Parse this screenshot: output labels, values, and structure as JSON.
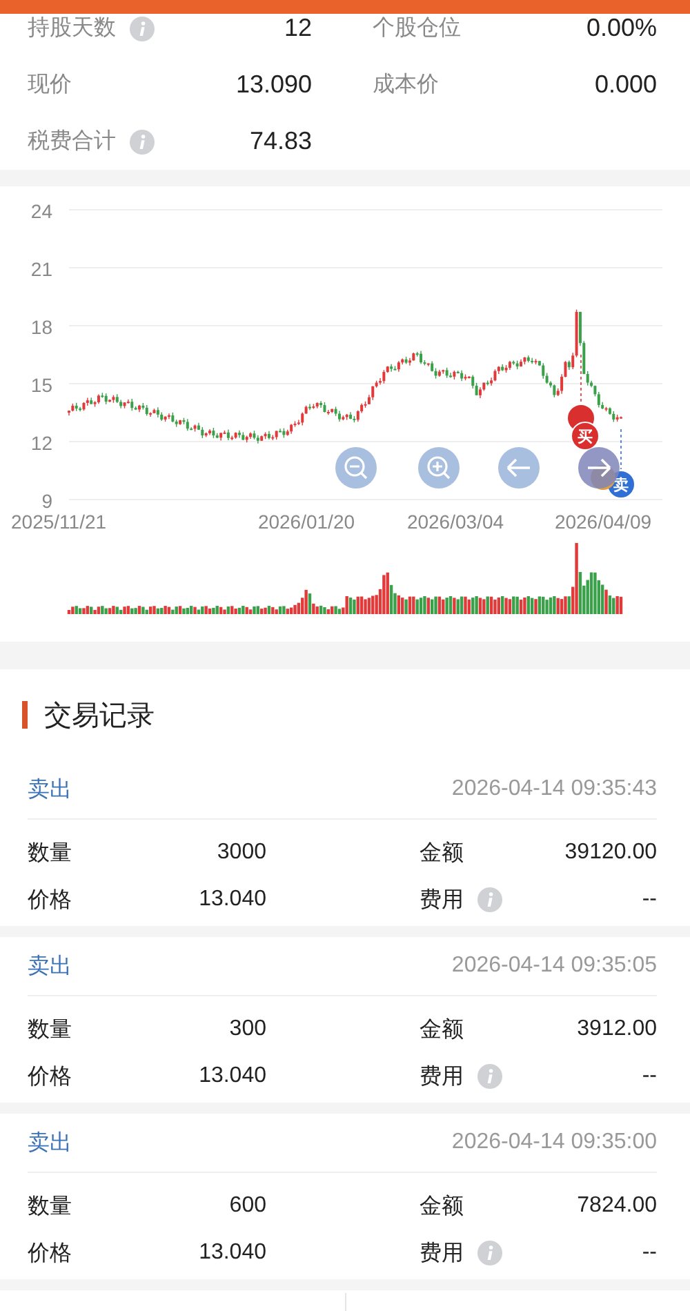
{
  "stats": [
    {
      "label": "持股天数",
      "info": true,
      "value": "12"
    },
    {
      "label": "个股仓位",
      "info": false,
      "value": "0.00%"
    },
    {
      "label": "现价",
      "info": false,
      "value": "13.090"
    },
    {
      "label": "成本价",
      "info": false,
      "value": "0.000"
    },
    {
      "label": "税费合计",
      "info": true,
      "value": "74.83"
    }
  ],
  "chart": {
    "y_labels": [
      "24",
      "21",
      "18",
      "15",
      "12",
      "9"
    ],
    "x_labels": [
      "2025/11/21",
      "2026/01/20",
      "2026/03/04",
      "2026/04/09"
    ],
    "markers": [
      {
        "kind": "buy"
      },
      {
        "kind": "buy",
        "text": "买"
      },
      {
        "kind": "sell",
        "text": "卖"
      }
    ]
  },
  "section_title": "交易记录",
  "trades": [
    {
      "type": "卖出",
      "time": "2026-04-14 09:35:43",
      "fields": [
        {
          "label": "数量",
          "value": "3000",
          "info": false
        },
        {
          "label": "金额",
          "value": "39120.00",
          "info": false
        },
        {
          "label": "价格",
          "value": "13.040",
          "info": false
        },
        {
          "label": "费用",
          "value": "--",
          "info": true
        }
      ]
    },
    {
      "type": "卖出",
      "time": "2026-04-14 09:35:05",
      "fields": [
        {
          "label": "数量",
          "value": "300",
          "info": false
        },
        {
          "label": "金额",
          "value": "3912.00",
          "info": false
        },
        {
          "label": "价格",
          "value": "13.040",
          "info": false
        },
        {
          "label": "费用",
          "value": "--",
          "info": true
        }
      ]
    },
    {
      "type": "卖出",
      "time": "2026-04-14 09:35:00",
      "fields": [
        {
          "label": "数量",
          "value": "600",
          "info": false
        },
        {
          "label": "金额",
          "value": "7824.00",
          "info": false
        },
        {
          "label": "价格",
          "value": "13.040",
          "info": false
        },
        {
          "label": "费用",
          "value": "--",
          "info": true
        }
      ]
    }
  ]
}
